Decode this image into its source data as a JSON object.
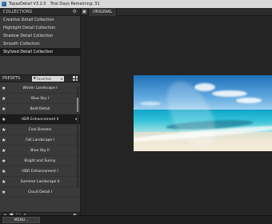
{
  "window": {
    "app_name": "TopazDetail V3.2.0",
    "trial_text": "Trial Days Remaining: 31"
  },
  "collections": {
    "title": "COLLECTIONS",
    "settings_icon": "gear-icon",
    "items": [
      {
        "label": "Creative Detail Collection",
        "active": false
      },
      {
        "label": "Highlight Detail Collection",
        "active": false
      },
      {
        "label": "Shadow Detail Collection",
        "active": false
      },
      {
        "label": "Smooth Collection",
        "active": false
      },
      {
        "label": "Stylized Detail Collection",
        "active": true
      }
    ]
  },
  "presets": {
    "title": "PRESETS",
    "filter_value": "Favorites",
    "filter_icon": "star-icon",
    "grid_icon": "grid-view-icon",
    "items": [
      {
        "label": "Winter Landscape I",
        "favorite": true,
        "selected": false
      },
      {
        "label": "Blue Sky I",
        "favorite": true,
        "selected": false
      },
      {
        "label": "Bold Detail",
        "favorite": true,
        "selected": false
      },
      {
        "label": "HDR Enhancement II",
        "favorite": true,
        "selected": true
      },
      {
        "label": "Cool Dreams",
        "favorite": true,
        "selected": false
      },
      {
        "label": "Fall Landscape I",
        "favorite": true,
        "selected": false
      },
      {
        "label": "Blue Sky II",
        "favorite": true,
        "selected": false
      },
      {
        "label": "Bright and Sunny",
        "favorite": true,
        "selected": false
      },
      {
        "label": "HDR Enhancement I",
        "favorite": true,
        "selected": false
      },
      {
        "label": "Summer Landscape II",
        "favorite": true,
        "selected": false
      },
      {
        "label": "Cloud Detail I",
        "favorite": true,
        "selected": false
      }
    ],
    "toolbar_icons": [
      "plus-icon",
      "delete-icon",
      "duplicate-icon",
      "share-icon"
    ],
    "toolbar_right_icon": "camera-icon"
  },
  "view": {
    "tabs": [
      {
        "label": "ORIGINAL",
        "active": true
      }
    ],
    "view_mode_icon": "split-view-icon"
  },
  "footer": {
    "menu_label": "MENU..."
  },
  "colors": {
    "accent": "#1f6fb8",
    "panel": "#3a3a3a",
    "selection": "#1b1b1b"
  }
}
